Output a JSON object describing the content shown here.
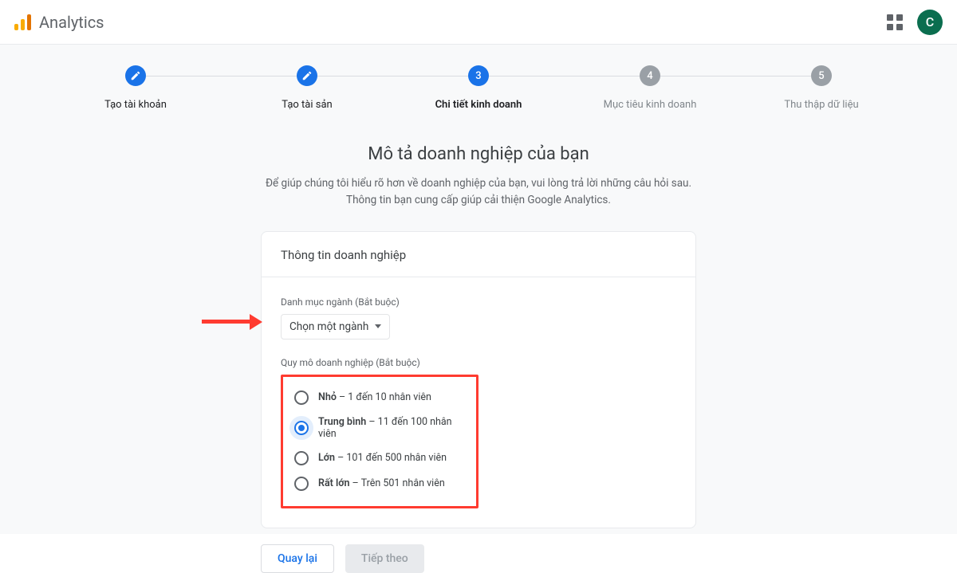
{
  "header": {
    "app_title": "Analytics",
    "avatar_initial": "C"
  },
  "stepper": {
    "steps": [
      {
        "label": "Tạo tài khoản",
        "state": "completed",
        "badge": "pencil"
      },
      {
        "label": "Tạo tài sản",
        "state": "completed",
        "badge": "pencil"
      },
      {
        "label": "Chi tiết kinh doanh",
        "state": "current",
        "badge": "3"
      },
      {
        "label": "Mục tiêu kinh doanh",
        "state": "upcoming",
        "badge": "4"
      },
      {
        "label": "Thu thập dữ liệu",
        "state": "upcoming",
        "badge": "5"
      }
    ]
  },
  "section": {
    "title": "Mô tả doanh nghiệp của bạn",
    "desc_line1": "Để giúp chúng tôi hiểu rõ hơn về doanh nghiệp của bạn, vui lòng trả lời những câu hỏi sau.",
    "desc_line2": "Thông tin bạn cung cấp giúp cải thiện Google Analytics."
  },
  "card": {
    "title": "Thông tin doanh nghiệp",
    "industry_label": "Danh mục ngành (Bắt buộc)",
    "industry_dropdown": "Chọn một ngành",
    "size_label": "Quy mô doanh nghiệp (Bắt buộc)",
    "size_options": [
      {
        "bold": "Nhỏ",
        "rest": " – 1 đến 10 nhân viên",
        "selected": false
      },
      {
        "bold": "Trung bình",
        "rest": " – 11 đến 100 nhân viên",
        "selected": true
      },
      {
        "bold": "Lớn",
        "rest": " – 101 đến 500 nhân viên",
        "selected": false
      },
      {
        "bold": "Rất lớn",
        "rest": " – Trên 501 nhân viên",
        "selected": false
      }
    ]
  },
  "buttons": {
    "back": "Quay lại",
    "next": "Tiếp theo"
  }
}
